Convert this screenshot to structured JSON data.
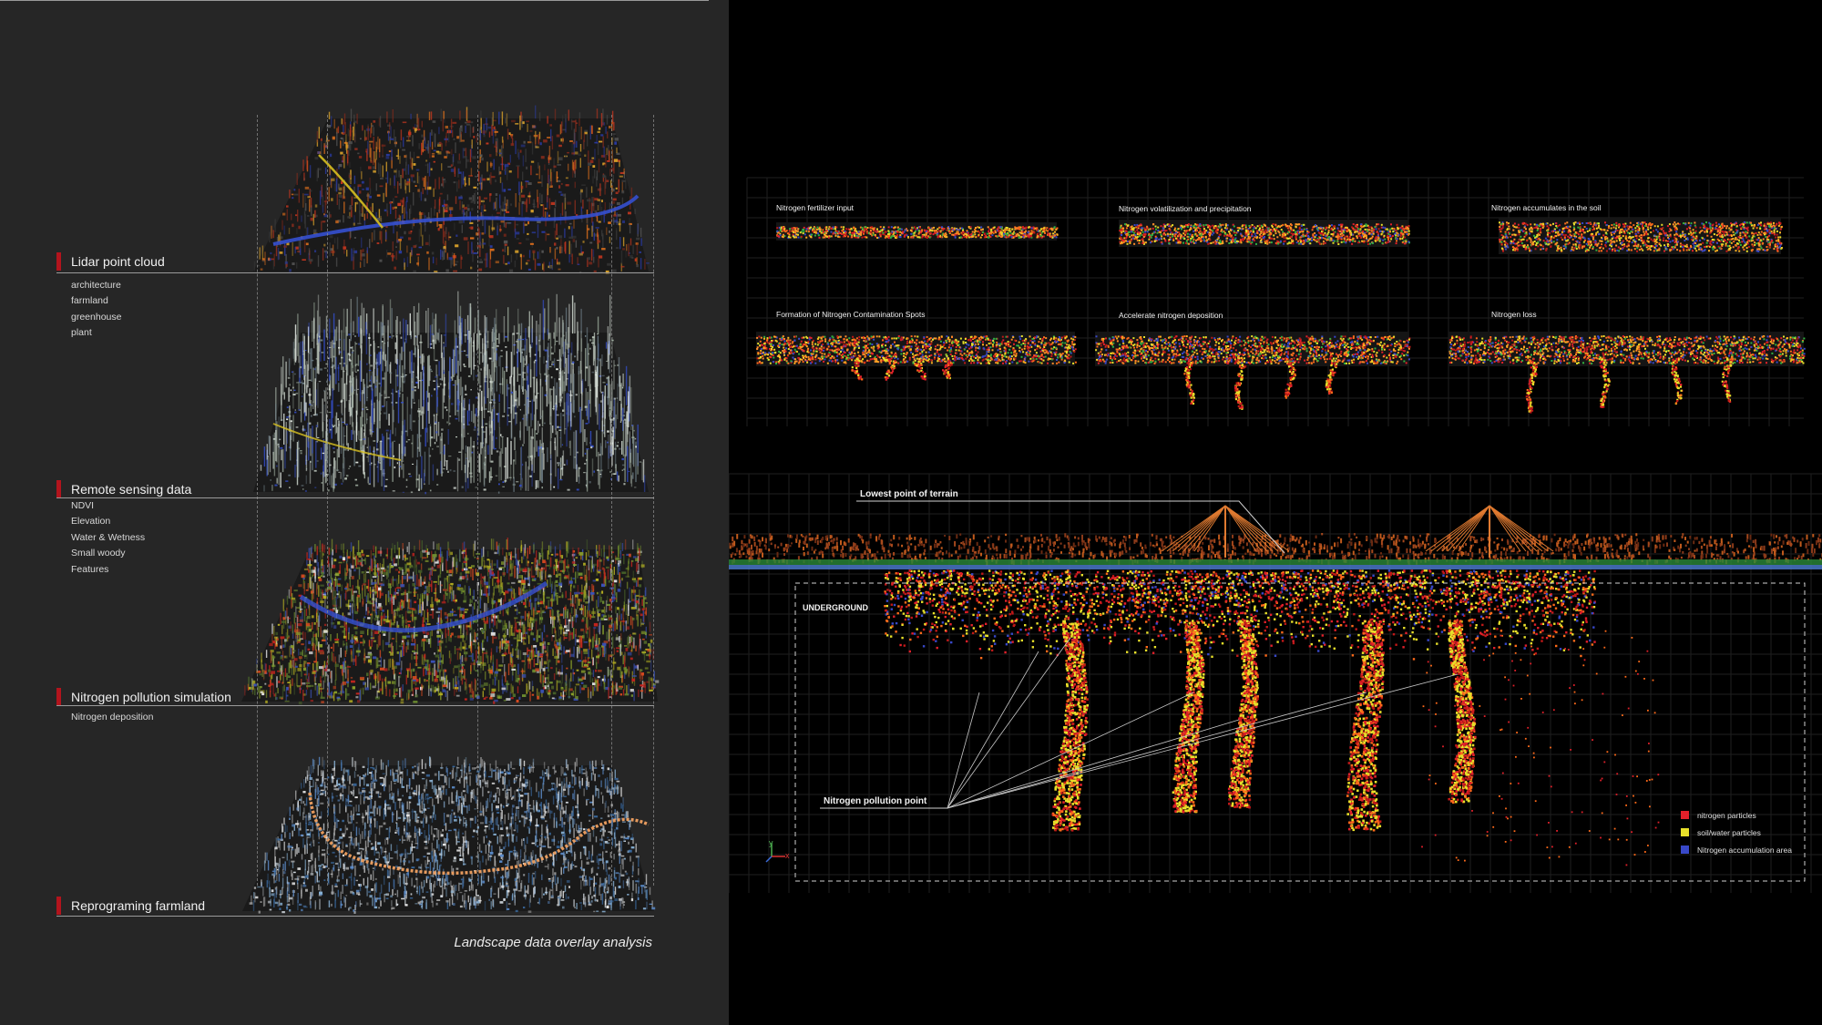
{
  "left": {
    "sections": [
      {
        "title": "Lidar point cloud",
        "items": [
          "architecture",
          "farmland",
          "greenhouse",
          "plant"
        ]
      },
      {
        "title": "Remote sensing data",
        "items": [
          "NDVI",
          "Elevation",
          "Water & Wetness",
          "Small woody",
          "Features"
        ]
      },
      {
        "title": "Nitrogen pollution simulation",
        "items": [
          "Nitrogen deposition"
        ]
      },
      {
        "title": "Reprograming farmland",
        "items": []
      }
    ],
    "caption": "Landscape data overlay analysis"
  },
  "right": {
    "panels": [
      "Nitrogen fertilizer input",
      "Nitrogen volatilization and precipitation",
      "Nitrogen accumulates in the soil",
      "Formation of Nitrogen Contamination Spots",
      "Accelerate nitrogen deposition",
      "Nitrogen loss"
    ],
    "labels": {
      "lowest_point": "Lowest point of terrain",
      "underground": "UNDERGROUND",
      "pollution_point": "Nitrogen pollution point"
    },
    "legend": [
      {
        "label": "nitrogen particles",
        "color": "#e0202a"
      },
      {
        "label": "soil/water particles",
        "color": "#e8e02a"
      },
      {
        "label": "Nitrogen accumulation area",
        "color": "#3848c8"
      }
    ],
    "axes": {
      "y": "y",
      "x": "x"
    }
  }
}
